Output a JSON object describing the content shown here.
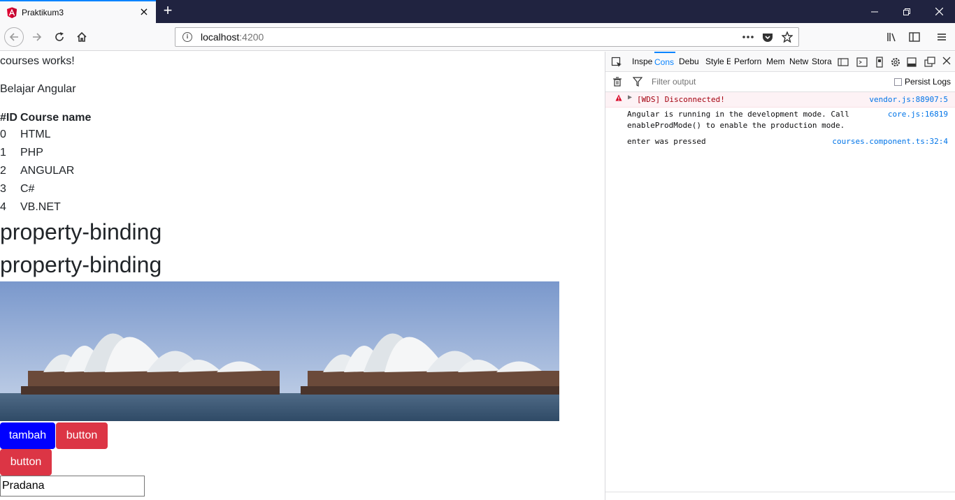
{
  "browser": {
    "tab_title": "Praktikum3",
    "new_tab_label": "+",
    "url_host": "localhost",
    "url_port": ":4200",
    "url_actions": [
      "page-actions-icon",
      "pocket-icon",
      "bookmark-star-icon"
    ],
    "window_controls": [
      "minimize-icon",
      "restore-icon",
      "close-icon"
    ]
  },
  "page": {
    "courses_works": "courses works!",
    "subtitle": "Belajar Angular",
    "table": {
      "headers": [
        "#ID",
        "Course name"
      ],
      "rows": [
        [
          "0",
          "HTML"
        ],
        [
          "1",
          "PHP"
        ],
        [
          "2",
          "ANGULAR"
        ],
        [
          "3",
          "C#"
        ],
        [
          "4",
          "VB.NET"
        ]
      ]
    },
    "heading_1": "property-binding",
    "heading_2": "property-binding",
    "buttons": {
      "tambah": "tambah",
      "button_1": "button",
      "button_2": "button"
    },
    "input_value": "Pradana"
  },
  "devtools": {
    "tabs": [
      "Inspe",
      "Cons",
      "Debu",
      "Style E",
      "Perforn",
      "Mem",
      "Netw",
      "Stora"
    ],
    "active_tab": "Cons",
    "filter_placeholder": "Filter output",
    "persist_logs": "Persist Logs",
    "logs": [
      {
        "level": "error",
        "message": "[WDS] Disconnected!",
        "source": "vendor.js:88907:5"
      },
      {
        "level": "log",
        "message_line1": "Angular is running in the development mode. Call",
        "message_line2": "enableProdMode() to enable the production mode.",
        "source": "core.js:16819"
      },
      {
        "level": "log",
        "message": "enter was pressed",
        "source": "courses.component.ts:32:4"
      }
    ]
  },
  "colors": {
    "tab_bar": "#202340",
    "accent": "#0a84ff",
    "btn_primary": "#0000ff",
    "btn_danger": "#dc3545"
  }
}
